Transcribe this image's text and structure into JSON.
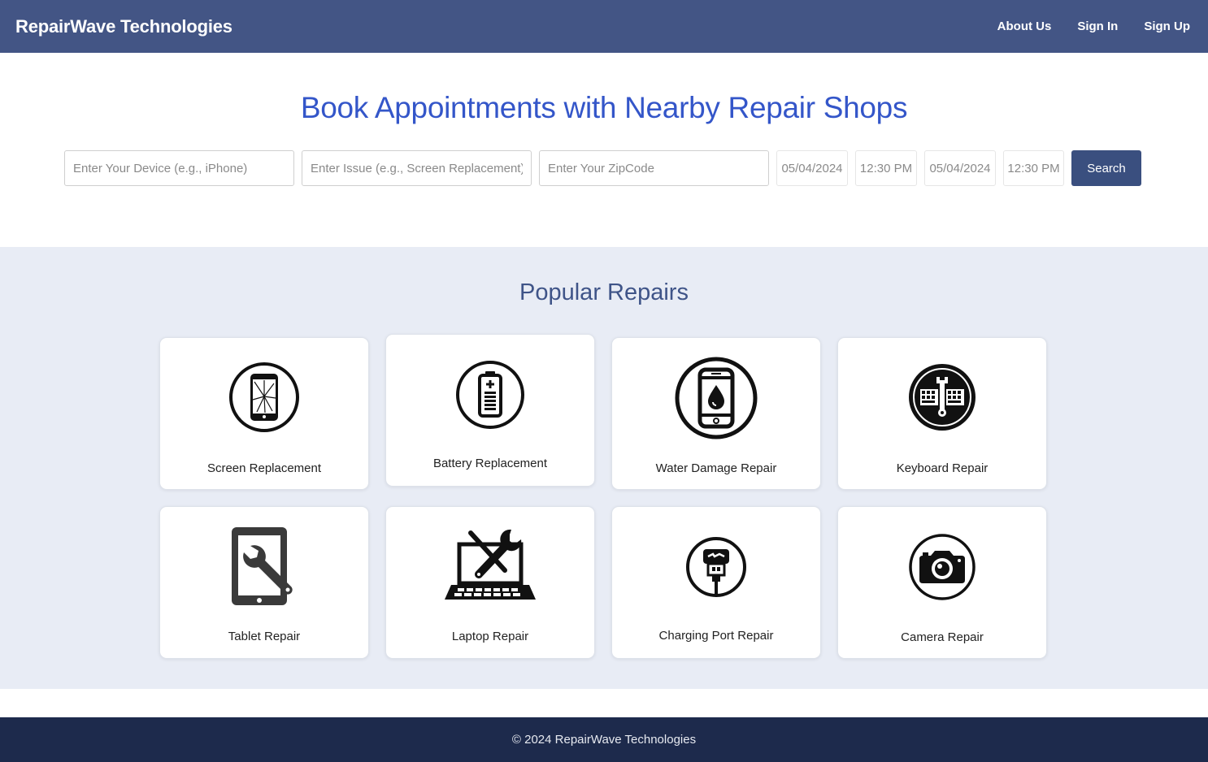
{
  "nav": {
    "brand": "RepairWave Technologies",
    "links": [
      "About Us",
      "Sign In",
      "Sign Up"
    ]
  },
  "hero": {
    "title": "Book Appointments with Nearby Repair Shops",
    "device_placeholder": "Enter Your Device (e.g., iPhone)",
    "issue_placeholder": "Enter Issue (e.g., Screen Replacement)",
    "zip_placeholder": "Enter Your ZipCode",
    "start_date": "05/04/2024",
    "start_time": "12:30 PM",
    "end_date": "05/04/2024",
    "end_time": "12:30 PM",
    "search_label": "Search"
  },
  "popular": {
    "title": "Popular Repairs",
    "cards": [
      {
        "label": "Screen Replacement",
        "icon": "cracked-phone-icon"
      },
      {
        "label": "Battery Replacement",
        "icon": "battery-icon"
      },
      {
        "label": "Water Damage Repair",
        "icon": "water-drop-phone-icon"
      },
      {
        "label": "Keyboard Repair",
        "icon": "keyboard-wrench-icon"
      },
      {
        "label": "Tablet Repair",
        "icon": "tablet-wrench-icon"
      },
      {
        "label": "Laptop Repair",
        "icon": "laptop-tools-icon"
      },
      {
        "label": "Charging Port Repair",
        "icon": "charging-port-icon"
      },
      {
        "label": "Camera Repair",
        "icon": "camera-icon"
      }
    ]
  },
  "footer": {
    "text": "© 2024 RepairWave Technologies"
  },
  "colors": {
    "navbar": "#435585",
    "hero_title": "#3456c9",
    "section_bg": "#e8ecf5",
    "search_button": "#3a4f7f",
    "footer": "#1d2a4c"
  }
}
